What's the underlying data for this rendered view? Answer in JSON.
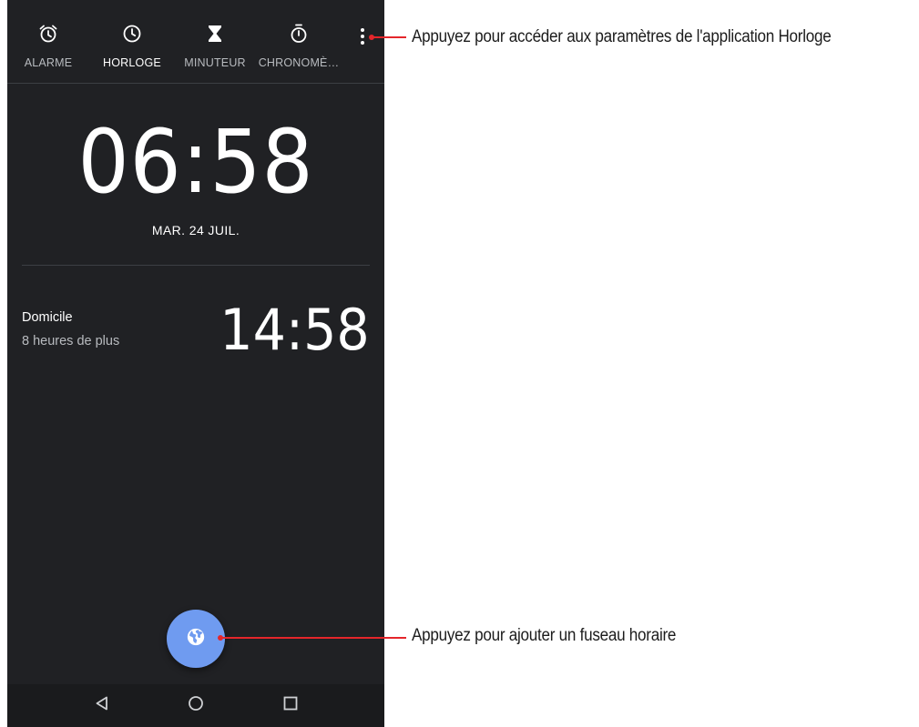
{
  "tabs": [
    {
      "label": "ALARME",
      "icon": "alarm-clock-icon",
      "active": false
    },
    {
      "label": "HORLOGE",
      "icon": "clock-icon",
      "active": true
    },
    {
      "label": "MINUTEUR",
      "icon": "hourglass-icon",
      "active": false
    },
    {
      "label": "CHRONOMÈ…",
      "icon": "stopwatch-icon",
      "active": false
    }
  ],
  "clock": {
    "time": "06:58",
    "date": "MAR. 24 JUIL."
  },
  "world_clock": {
    "city": "Domicile",
    "difference": "8 heures de plus",
    "time": "14:58"
  },
  "fab": {
    "icon": "globe-icon"
  },
  "navbar": {
    "back_icon": "back-triangle-icon",
    "home_icon": "home-circle-icon",
    "recent_icon": "recent-square-icon"
  },
  "callouts": {
    "settings": "Appuyez pour accéder aux paramètres de l'application Horloge",
    "add_timezone": "Appuyez pour ajouter un fuseau horaire"
  },
  "colors": {
    "background": "#202124",
    "accent": "#6f9bf0",
    "callout": "#e4262b"
  }
}
